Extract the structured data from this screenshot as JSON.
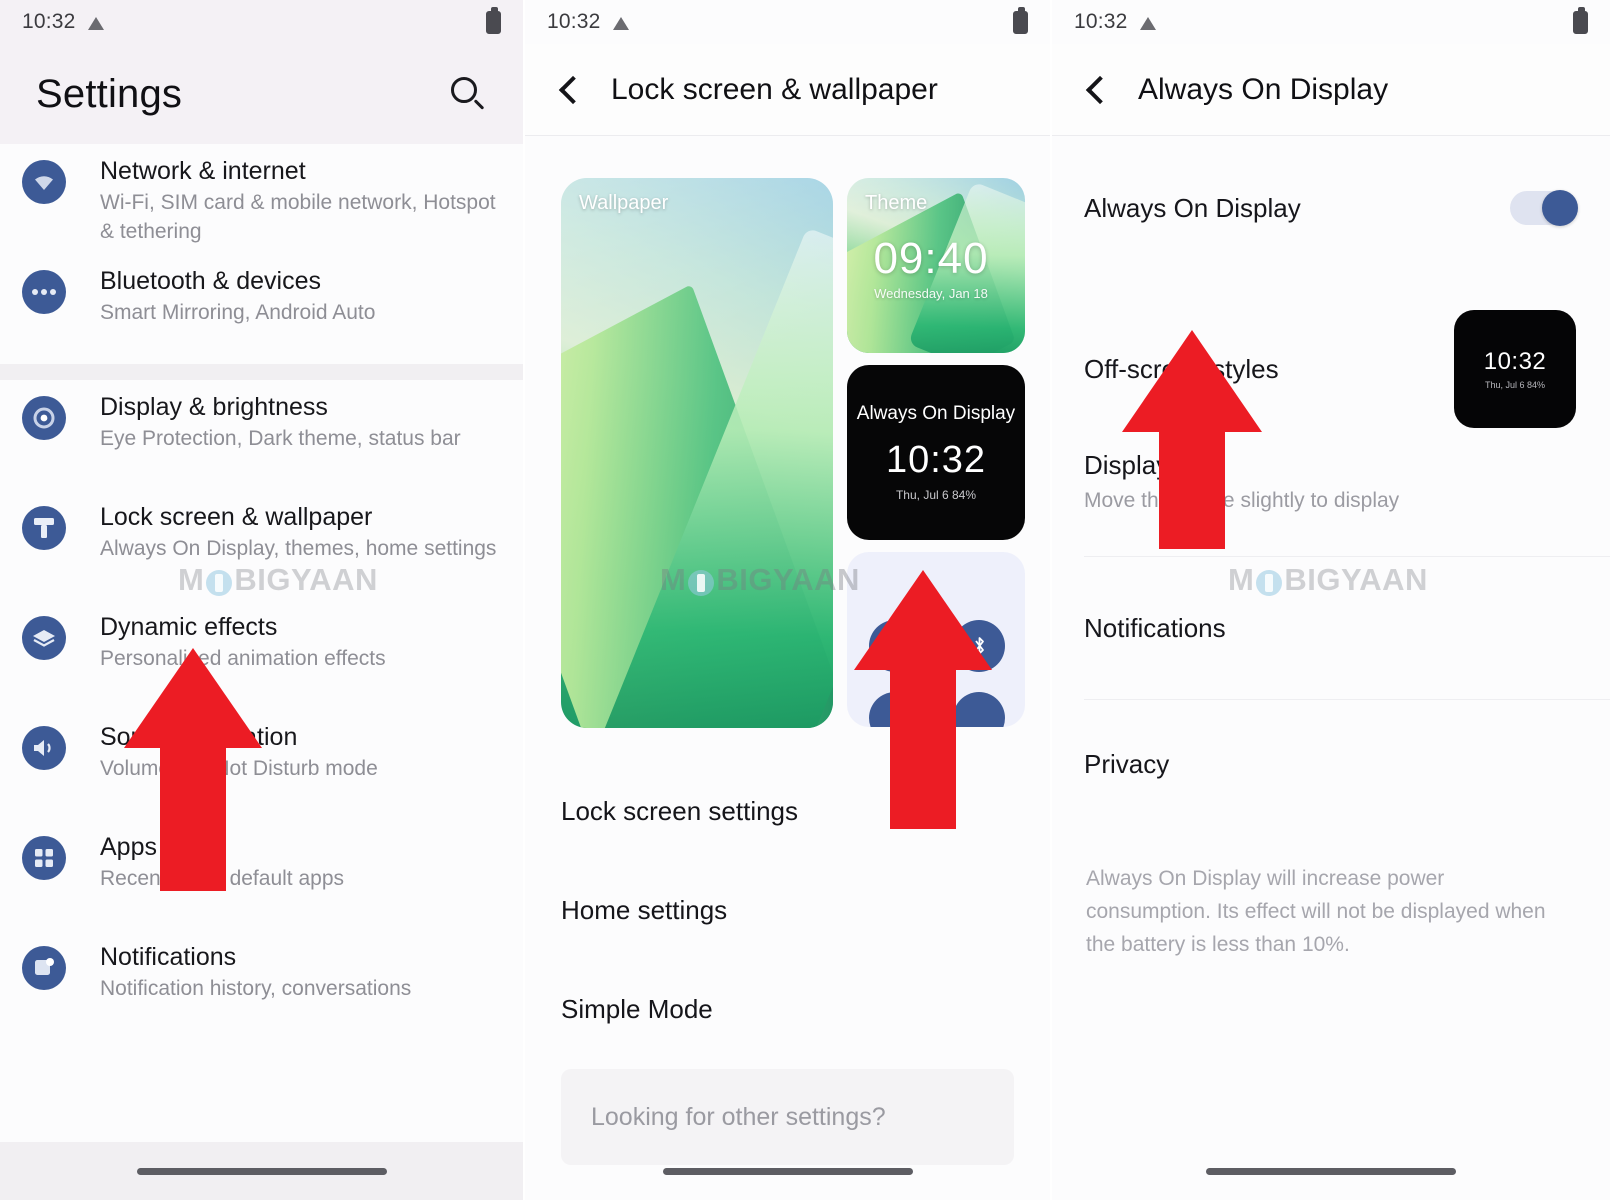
{
  "status_bar": {
    "time": "10:32",
    "battery_icon": "battery-icon",
    "signal_icon": "triangle-signal-icon"
  },
  "panel1": {
    "title": "Settings",
    "search_icon": "search-icon",
    "items": [
      {
        "icon": "wifi-icon",
        "title": "Network & internet",
        "subtitle": "Wi-Fi, SIM card & mobile network, Hotspot & tethering"
      },
      {
        "icon": "bluetooth-devices-icon",
        "title": "Bluetooth & devices",
        "subtitle": "Smart Mirroring, Android Auto"
      },
      {
        "icon": "display-brightness-icon",
        "title": "Display & brightness",
        "subtitle": "Eye Protection, Dark theme, status bar"
      },
      {
        "icon": "lock-screen-wallpaper-icon",
        "title": "Lock screen & wallpaper",
        "subtitle": "Always On Display, themes, home settings"
      },
      {
        "icon": "dynamic-effects-icon",
        "title": "Dynamic effects",
        "subtitle": "Personalised animation effects"
      },
      {
        "icon": "sound-vibration-icon",
        "title": "Sound & vibration",
        "subtitle": "Volume, Do Not Disturb mode"
      },
      {
        "icon": "apps-icon",
        "title": "Apps",
        "subtitle": "Recent apps, default apps"
      },
      {
        "icon": "notifications-icon",
        "title": "Notifications",
        "subtitle": "Notification history, conversations"
      }
    ]
  },
  "panel2": {
    "back_icon": "back-chevron-icon",
    "title": "Lock screen & wallpaper",
    "cards": {
      "wallpaper": {
        "label": "Wallpaper"
      },
      "theme": {
        "label": "Theme",
        "time": "09:40",
        "date": "Wednesday, Jan 18"
      },
      "aod": {
        "label": "Always On Display",
        "time": "10:32",
        "date": "Thu, Jul 6  84%"
      },
      "quick_settings": {
        "bluetooth_icon": "bluetooth-icon"
      }
    },
    "rows": [
      {
        "label": "Lock screen settings"
      },
      {
        "label": "Home settings"
      },
      {
        "label": "Simple Mode"
      }
    ],
    "search_placeholder": "Looking for other settings?"
  },
  "panel3": {
    "back_icon": "back-chevron-icon",
    "title": "Always On Display",
    "rows": [
      {
        "label": "Always On Display",
        "control": "toggle",
        "toggle_on": true
      },
      {
        "label": "Off-screen styles",
        "control": "thumbnail",
        "thumb_time": "10:32",
        "thumb_date": "Thu, Jul 6  84%"
      },
      {
        "label": "Display",
        "sublabel": "Move the phone slightly to display",
        "control": "none"
      },
      {
        "label": "Notifications",
        "control": "none"
      },
      {
        "label": "Privacy",
        "control": "none"
      }
    ],
    "footnote": "Always On Display will increase power consumption. Its effect will not be displayed when the battery is less than 10%."
  },
  "watermark": {
    "text_before": "M",
    "text_after": "BIGYAAN"
  },
  "colors": {
    "accent_blue": "#3d5a96",
    "arrow_red": "#ec1c24",
    "header_bg": "#f4f1f5"
  }
}
